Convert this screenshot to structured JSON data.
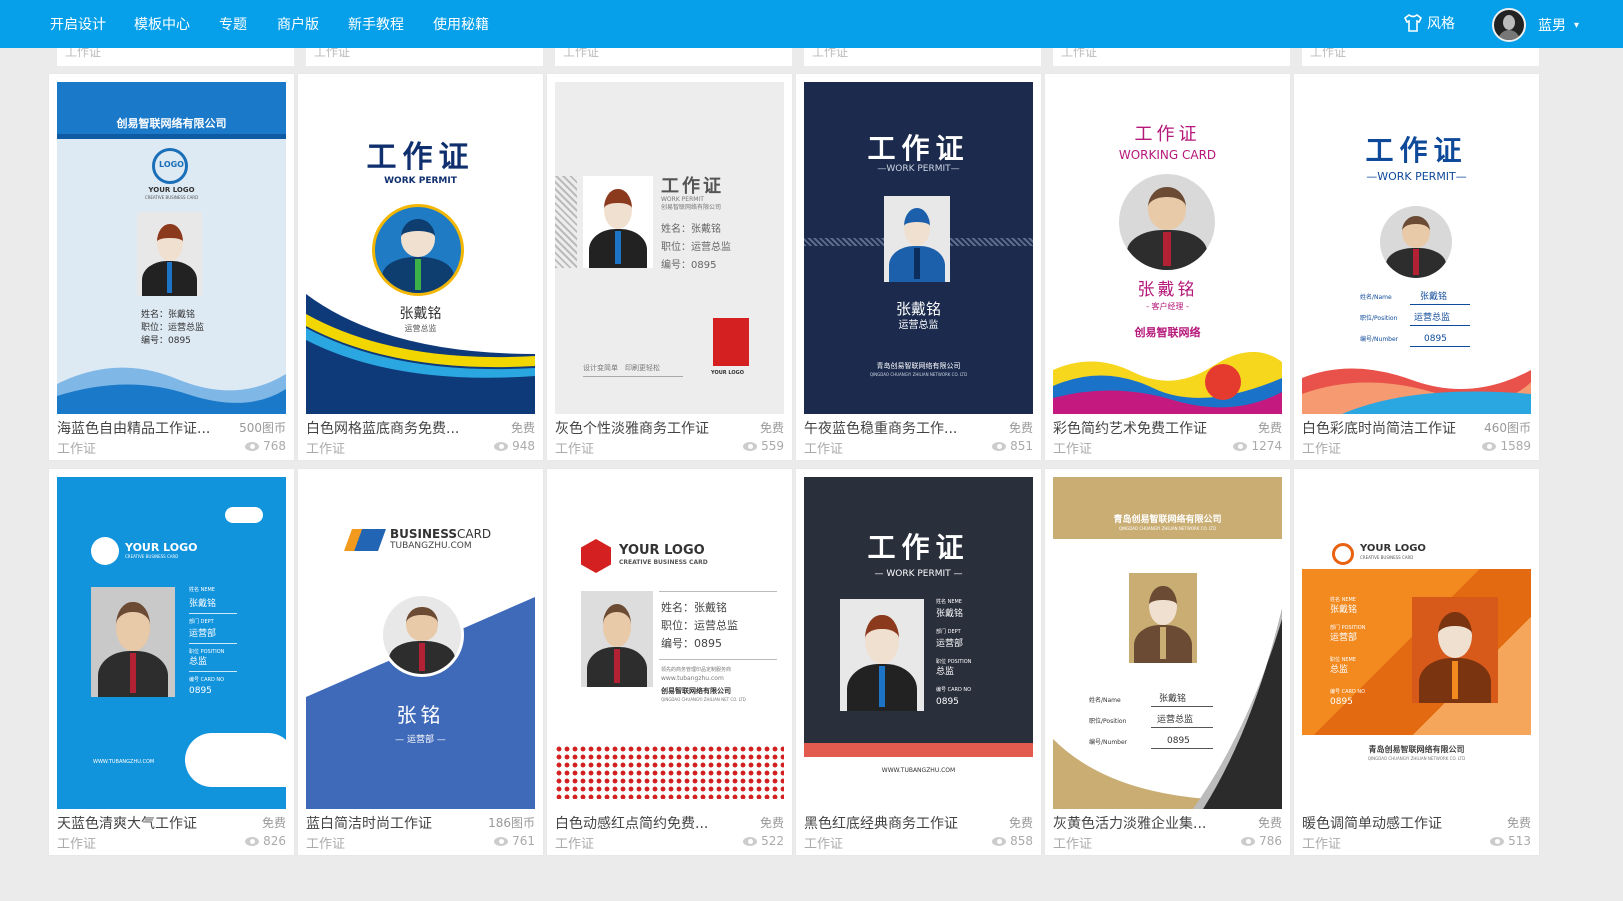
{
  "nav": {
    "items": [
      "开启设计",
      "模板中心",
      "专题",
      "商户版",
      "新手教程",
      "使用秘籍"
    ],
    "style_label": "风格",
    "user_name": "蓝男"
  },
  "colors": {
    "topbar": "#06a0ea",
    "background": "#ebebeb",
    "card": "#ffffff"
  },
  "ghost_row": [
    "工作证",
    "工作证",
    "工作证",
    "工作证",
    "工作证",
    "工作证"
  ],
  "cards": [
    {
      "title": "海蓝色自由精品工作证...",
      "price": "500图币",
      "category": "工作证",
      "views": "768",
      "thumb": {
        "company": "创易智联网络有限公司",
        "logo": "LOGO",
        "your_logo": "YOUR LOGO",
        "sub": "CREATIVE BUSINESS CARD",
        "name": "姓名：张戴铭",
        "position": "职位：运营总监",
        "number": "编号：0895"
      }
    },
    {
      "title": "白色网格蓝底商务免费...",
      "price": "免费",
      "category": "工作证",
      "views": "948",
      "thumb": {
        "heading": "工作证",
        "sub": "WORK PERMIT",
        "name": "张戴铭",
        "role": "运营总监"
      }
    },
    {
      "title": "灰色个性淡雅商务工作证",
      "price": "免费",
      "category": "工作证",
      "views": "559",
      "thumb": {
        "heading": "工作证",
        "sub": "WORK PERMIT",
        "company": "创易智联网络有限公司",
        "name": "姓名：张戴铭",
        "position": "职位：运营总监",
        "number": "编号：0895",
        "slogan": "设计变简单　印刷更轻松",
        "logo": "YOUR LOGO"
      }
    },
    {
      "title": "午夜蓝色稳重商务工作...",
      "price": "免费",
      "category": "工作证",
      "views": "851",
      "thumb": {
        "heading": "工作证",
        "sub": "—WORK PERMIT—",
        "name": "张戴铭",
        "role": "运营总监",
        "company": "青岛创易智联网络有限公司",
        "company_en": "QINGDAO CHUANGYI ZHILIAN NETWORK CO. LTD"
      }
    },
    {
      "title": "彩色简约艺术免费工作证",
      "price": "免费",
      "category": "工作证",
      "views": "1274",
      "thumb": {
        "heading": "工作证",
        "sub": "WORKING CARD",
        "name": "张戴铭",
        "role": "- 客户经理 -",
        "company": "创易智联网络"
      }
    },
    {
      "title": "白色彩底时尚简洁工作证",
      "price": "460图币",
      "category": "工作证",
      "views": "1589",
      "thumb": {
        "heading": "工作证",
        "sub": "—WORK PERMIT—",
        "labels": [
          "姓名/Name",
          "职位/Position",
          "编号/Number"
        ],
        "values": [
          "张戴铭",
          "运营总监",
          "0895"
        ]
      }
    },
    {
      "title": "天蓝色清爽大气工作证",
      "price": "免费",
      "category": "工作证",
      "views": "826",
      "thumb": {
        "logo": "YOUR LOGO",
        "sub": "CREATIVE BUSINESS CARD",
        "labels": [
          "姓名 NEME",
          "部门 DEPT",
          "职位 POSITION",
          "编号 CARD NO"
        ],
        "values": [
          "张戴铭",
          "运营部",
          "总监",
          "0895"
        ],
        "url": "WWW.TUBANGZHU.COM"
      }
    },
    {
      "title": "蓝白简洁时尚工作证",
      "price": "186图币",
      "category": "工作证",
      "views": "761",
      "thumb": {
        "brand_bold": "BUSINESS",
        "brand_light": "CARD",
        "url": "TUBANGZHU.COM",
        "name": "张铭",
        "dept": "— 运营部 —"
      }
    },
    {
      "title": "白色动感红点简约免费...",
      "price": "免费",
      "category": "工作证",
      "views": "522",
      "thumb": {
        "logo": "YOUR LOGO",
        "sub": "CREATIVE BUSINESS CARD",
        "name": "姓名：张戴铭",
        "position": "职位：运营总监",
        "number": "编号：0895",
        "note": "领先的商务管理印品定制服务商",
        "url": "www.tubangzhu.com",
        "company": "创易智联网络有限公司",
        "company_en": "QINGDAO CHUANGYI ZHILIAN NET CO. LTD"
      }
    },
    {
      "title": "黑色红底经典商务工作证",
      "price": "免费",
      "category": "工作证",
      "views": "858",
      "thumb": {
        "heading": "工作证",
        "sub": "— WORK PERMIT —",
        "labels": [
          "姓名 NEME",
          "部门 DEPT",
          "职位 POSITION",
          "编号 CARD NO"
        ],
        "values": [
          "张戴铭",
          "运营部",
          "总监",
          "0895"
        ],
        "url": "WWW.TUBANGZHU.COM"
      }
    },
    {
      "title": "灰黄色活力淡雅企业集...",
      "price": "免费",
      "category": "工作证",
      "views": "786",
      "thumb": {
        "company": "青岛创易智联网络有限公司",
        "company_en": "QINGDAO CHUANGYI ZHILIAN NETWORK CO. LTD",
        "labels": [
          "姓名/Name",
          "职位/Position",
          "编号/Number"
        ],
        "values": [
          "张戴铭",
          "运营总监",
          "0895"
        ]
      }
    },
    {
      "title": "暖色调简单动感工作证",
      "price": "免费",
      "category": "工作证",
      "views": "513",
      "thumb": {
        "logo": "YOUR LOGO",
        "sub": "CREATIVE BUSINESS CARD",
        "labels": [
          "姓名 NEME",
          "部门 POSITION",
          "职位 NEME",
          "编号 CARD NO"
        ],
        "values": [
          "张戴铭",
          "运营部",
          "总监",
          "0895"
        ],
        "company": "青岛创易智联网络有限公司",
        "company_en": "QINGDAO CHUANGYI ZHILIAN NETWORK CO. LTD"
      }
    }
  ]
}
